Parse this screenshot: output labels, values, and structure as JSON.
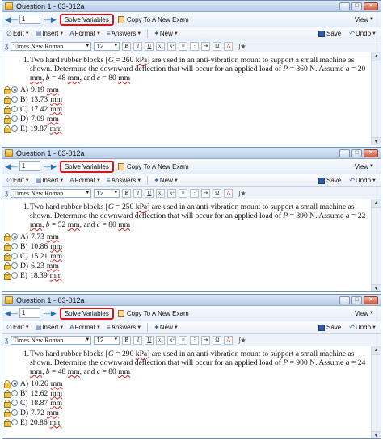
{
  "windows": [
    {
      "title": "Question 1 - 03-012a",
      "question_number_value": "1",
      "solve_label": "Solve Variables",
      "copy_label": "Copy To A New Exam",
      "view_label": "View",
      "toolbar": {
        "edit": "Edit",
        "insert": "Insert",
        "format": "Format",
        "answers": "Answers",
        "new": "New",
        "save": "Save",
        "undo": "Undo"
      },
      "font": {
        "family": "Times New Roman",
        "size": "12"
      },
      "question": {
        "num": "1.",
        "p1": "Two hard rubber blocks [",
        "G_sym": "G",
        "p2": " = 260 ",
        "unit": "kPa",
        "p3": "] are used in an anti-vibration mount to support a small machine as shown. Determine the downward deflection that will occur for an applied load of ",
        "P_sym": "P",
        "p4": " = 860 N.  Assume ",
        "a_sym": "a",
        "p5": " = 20 ",
        "a_unit": "mm",
        "p6": ", ",
        "b_sym": "b",
        "p7": " = 48 ",
        "b_unit": "mm",
        "p8": ", and ",
        "c_sym": "c",
        "p9": " = 80 ",
        "c_unit": "mm"
      },
      "choices": [
        {
          "letter": "A)",
          "value": "9.19",
          "unit": "mm"
        },
        {
          "letter": "B)",
          "value": "13.73",
          "unit": "mm"
        },
        {
          "letter": "C)",
          "value": "17.42",
          "unit": "mm"
        },
        {
          "letter": "D)",
          "value": "7.09",
          "unit": "mm"
        },
        {
          "letter": "E)",
          "value": "19.87",
          "unit": "mm"
        }
      ]
    },
    {
      "title": "Question 1 - 03-012a",
      "question_number_value": "1",
      "solve_label": "Solve Variables",
      "copy_label": "Copy To A New Exam",
      "view_label": "View",
      "toolbar": {
        "edit": "Edit",
        "insert": "Insert",
        "format": "Format",
        "answers": "Answers",
        "new": "New",
        "save": "Save",
        "undo": "Undo"
      },
      "font": {
        "family": "Times New Roman",
        "size": "12"
      },
      "question": {
        "num": "1.",
        "p1": "Two hard rubber blocks [",
        "G_sym": "G",
        "p2": " = 250 ",
        "unit": "kPa",
        "p3": "] are used in an anti-vibration mount to support a small machine as shown. Determine the downward deflection that will occur for an applied load of ",
        "P_sym": "P",
        "p4": " = 890 N.  Assume ",
        "a_sym": "a",
        "p5": " = 22 ",
        "a_unit": "mm",
        "p6": ", ",
        "b_sym": "b",
        "p7": " = 52 ",
        "b_unit": "mm",
        "p8": ", and ",
        "c_sym": "c",
        "p9": " = 80 ",
        "c_unit": "mm"
      },
      "choices": [
        {
          "letter": "A)",
          "value": "7.73",
          "unit": "mm"
        },
        {
          "letter": "B)",
          "value": "10.86",
          "unit": "mm"
        },
        {
          "letter": "C)",
          "value": "15.21",
          "unit": "mm"
        },
        {
          "letter": "D)",
          "value": "6.23",
          "unit": "mm"
        },
        {
          "letter": "E)",
          "value": "18.39",
          "unit": "mm"
        }
      ]
    },
    {
      "title": "Question 1 - 03-012a",
      "question_number_value": "1",
      "solve_label": "Solve Variables",
      "copy_label": "Copy To A New Exam",
      "view_label": "View",
      "toolbar": {
        "edit": "Edit",
        "insert": "Insert",
        "format": "Format",
        "answers": "Answers",
        "new": "New",
        "save": "Save",
        "undo": "Undo"
      },
      "font": {
        "family": "Times New Roman",
        "size": "12"
      },
      "question": {
        "num": "1.",
        "p1": "Two hard rubber blocks [",
        "G_sym": "G",
        "p2": " = 290 ",
        "unit": "kPa",
        "p3": "] are used in an anti-vibration mount to support a small machine as shown. Determine the downward deflection that will occur for an applied load of ",
        "P_sym": "P",
        "p4": " = 900 N.  Assume ",
        "a_sym": "a",
        "p5": " = 24 ",
        "a_unit": "mm",
        "p6": ", ",
        "b_sym": "b",
        "p7": " = 48 ",
        "b_unit": "mm",
        "p8": ", and ",
        "c_sym": "c",
        "p9": " = 80 ",
        "c_unit": "mm"
      },
      "choices": [
        {
          "letter": "A)",
          "value": "10.26",
          "unit": "mm"
        },
        {
          "letter": "B)",
          "value": "12.62",
          "unit": "mm"
        },
        {
          "letter": "C)",
          "value": "18.87",
          "unit": "mm"
        },
        {
          "letter": "D)",
          "value": "7.72",
          "unit": "mm"
        },
        {
          "letter": "E)",
          "value": "20.86",
          "unit": "mm"
        }
      ]
    }
  ],
  "icons": {
    "nav_back": "left-arrow-icon",
    "nav_forward": "right-arrow-icon",
    "solve": "solve-icon",
    "copy": "copy-icon",
    "lock": "lock-icon",
    "save": "floppy-disk-icon",
    "undo": "undo-icon"
  },
  "colors": {
    "highlight_border": "#d0181d",
    "window_border": "#6d8fb8",
    "accent": "#2b6fc0"
  }
}
